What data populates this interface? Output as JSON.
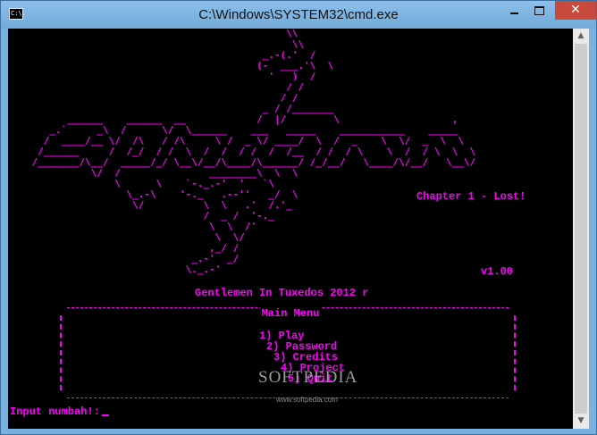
{
  "window": {
    "title": "C:\\Windows\\SYSTEM32\\cmd.exe",
    "icon_label": "C:\\.",
    "controls": {
      "minimize": "minimize-icon",
      "maximize": "maximize-icon",
      "close": "✕"
    }
  },
  "console": {
    "chapter": "Chapter 1 - Lost!",
    "version": "v1.00",
    "credit": "Gentlemen In Tuxedos 2012 r",
    "menu_title": "Main Menu",
    "menu_items": [
      "1) Play",
      "2) Password",
      "3) Credits",
      "4) Project",
      "5) Quit"
    ],
    "prompt": "Input numbah!:"
  },
  "watermark": {
    "text": "SOFTPEDIA",
    "url": "www.softpedia.com"
  },
  "colors": {
    "console_bg": "#000000",
    "console_text": "#ff00ff",
    "titlebar": "#78b0df",
    "close": "#c74a3c"
  }
}
